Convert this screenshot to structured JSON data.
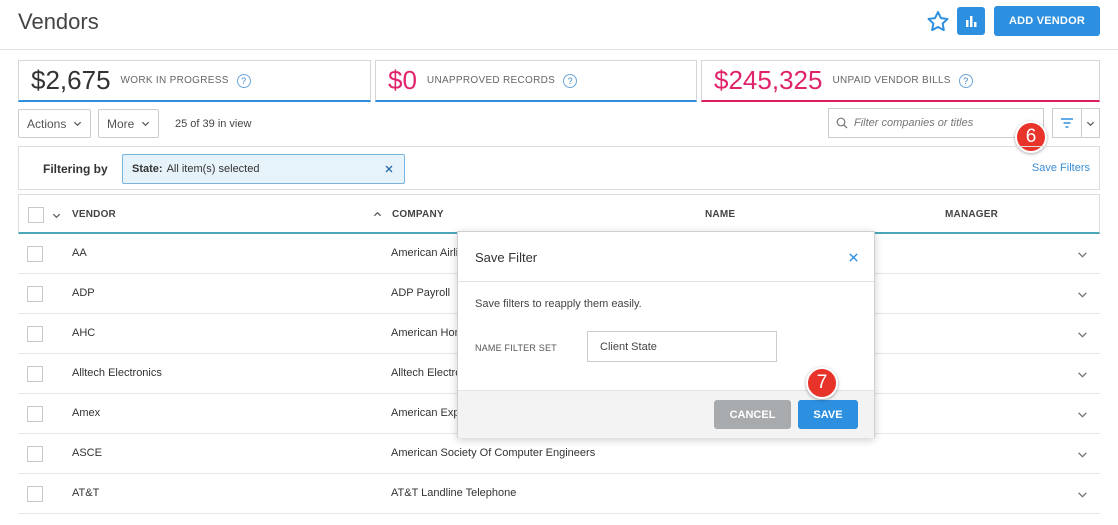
{
  "header": {
    "title": "Vendors",
    "add_vendor_label": "ADD VENDOR"
  },
  "stats": [
    {
      "value": "$2,675",
      "label": "WORK IN PROGRESS",
      "help": "?"
    },
    {
      "value": "$0",
      "label": "UNAPPROVED RECORDS",
      "help": "?"
    },
    {
      "value": "$245,325",
      "label": "UNPAID VENDOR BILLS",
      "help": "?"
    }
  ],
  "toolbar": {
    "actions_label": "Actions",
    "more_label": "More",
    "in_view": "25 of 39 in view",
    "search_placeholder": "Filter companies or titles"
  },
  "filters": {
    "filtering_by": "Filtering by",
    "chip_key": "State:",
    "chip_value": "All item(s) selected",
    "save_filters": "Save Filters"
  },
  "table": {
    "columns": {
      "vendor": "VENDOR",
      "company": "COMPANY",
      "name": "NAME",
      "manager": "MANAGER"
    },
    "rows": [
      {
        "vendor": "AA",
        "company": "American Airlines",
        "name": "",
        "manager": ""
      },
      {
        "vendor": "ADP",
        "company": "ADP Payroll",
        "name": "",
        "manager": ""
      },
      {
        "vendor": "AHC",
        "company": "American Home",
        "name": "",
        "manager": ""
      },
      {
        "vendor": "Alltech Electronics",
        "company": "Alltech Electronics",
        "name": "",
        "manager": ""
      },
      {
        "vendor": "Amex",
        "company": "American Express",
        "name": "",
        "manager": ""
      },
      {
        "vendor": "ASCE",
        "company": "American Society Of Computer Engineers",
        "name": "",
        "manager": ""
      },
      {
        "vendor": "AT&T",
        "company": "AT&T Landline Telephone",
        "name": "",
        "manager": ""
      }
    ]
  },
  "modal": {
    "title": "Save Filter",
    "description": "Save filters to reapply them easily.",
    "field_label": "NAME FILTER SET",
    "field_value": "Client State",
    "cancel_label": "CANCEL",
    "save_label": "SAVE"
  },
  "callouts": {
    "step6": "6",
    "step7": "7"
  },
  "colors": {
    "accent": "#2d8fe0",
    "alert": "#e0246b",
    "callout": "#e8332a"
  }
}
